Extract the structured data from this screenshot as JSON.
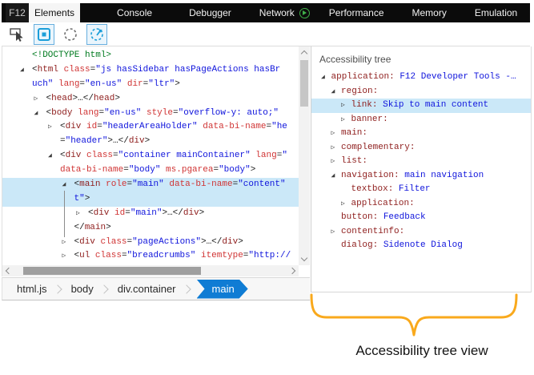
{
  "tabs": {
    "f12_label": "F12",
    "items": [
      {
        "label": "Elements",
        "active": true
      },
      {
        "label": "Console"
      },
      {
        "label": "Debugger"
      },
      {
        "label": "Network",
        "badge": "play"
      },
      {
        "label": "Performance"
      },
      {
        "label": "Memory"
      },
      {
        "label": "Emulation"
      }
    ]
  },
  "toolbar": {
    "icons": [
      {
        "name": "select-element-icon",
        "active": false
      },
      {
        "name": "highlight-elements-icon",
        "active": true
      },
      {
        "name": "dashed-circle-icon",
        "active": false
      },
      {
        "name": "refresh-dom-icon",
        "active": true
      }
    ]
  },
  "dom_tree": {
    "rows": [
      {
        "level": 0,
        "arrow": "none",
        "selected": false,
        "segments": [
          [
            "<!DOCTYPE html>",
            "doctype"
          ]
        ]
      },
      {
        "level": 0,
        "arrow": "expanded",
        "selected": false,
        "segments": [
          [
            "<",
            "p"
          ],
          [
            "html",
            "tag"
          ],
          [
            " ",
            "p"
          ],
          [
            "class",
            "attr"
          ],
          [
            "=",
            "p"
          ],
          [
            "\"js hasSidebar hasPageActions hasBr",
            "val"
          ]
        ]
      },
      {
        "level": 0,
        "arrow": "none",
        "selected": false,
        "segments": [
          [
            "uch\"",
            "val"
          ],
          [
            " ",
            "p"
          ],
          [
            "lang",
            "attr"
          ],
          [
            "=",
            "p"
          ],
          [
            "\"en-us\"",
            "val"
          ],
          [
            " ",
            "p"
          ],
          [
            "dir",
            "attr"
          ],
          [
            "=",
            "p"
          ],
          [
            "\"ltr\"",
            "val"
          ],
          [
            ">",
            "p"
          ]
        ]
      },
      {
        "level": 1,
        "arrow": "collapsed",
        "selected": false,
        "segments": [
          [
            "<",
            "p"
          ],
          [
            "head",
            "tag"
          ],
          [
            ">…</",
            "p"
          ],
          [
            "head",
            "tag"
          ],
          [
            ">",
            "p"
          ]
        ]
      },
      {
        "level": 1,
        "arrow": "expanded",
        "selected": false,
        "segments": [
          [
            "<",
            "p"
          ],
          [
            "body",
            "tag"
          ],
          [
            " ",
            "p"
          ],
          [
            "lang",
            "attr"
          ],
          [
            "=",
            "p"
          ],
          [
            "\"en-us\"",
            "val"
          ],
          [
            " ",
            "p"
          ],
          [
            "style",
            "attr"
          ],
          [
            "=",
            "p"
          ],
          [
            "\"overflow-y: auto;\"",
            "val"
          ]
        ]
      },
      {
        "level": 2,
        "arrow": "collapsed",
        "selected": false,
        "segments": [
          [
            "<",
            "p"
          ],
          [
            "div",
            "tag"
          ],
          [
            " ",
            "p"
          ],
          [
            "id",
            "attr"
          ],
          [
            "=",
            "p"
          ],
          [
            "\"headerAreaHolder\"",
            "val"
          ],
          [
            " ",
            "p"
          ],
          [
            "data-bi-name",
            "attr"
          ],
          [
            "=",
            "p"
          ],
          [
            "\"he",
            "val"
          ]
        ]
      },
      {
        "level": 2,
        "arrow": "none",
        "selected": false,
        "segments": [
          [
            "=",
            "p"
          ],
          [
            "\"header\"",
            "val"
          ],
          [
            ">…</",
            "p"
          ],
          [
            "div",
            "tag"
          ],
          [
            ">",
            "p"
          ]
        ]
      },
      {
        "level": 2,
        "arrow": "expanded",
        "selected": false,
        "segments": [
          [
            "<",
            "p"
          ],
          [
            "div",
            "tag"
          ],
          [
            " ",
            "p"
          ],
          [
            "class",
            "attr"
          ],
          [
            "=",
            "p"
          ],
          [
            "\"container mainContainer\"",
            "val"
          ],
          [
            " ",
            "p"
          ],
          [
            "lang",
            "attr"
          ],
          [
            "=",
            "p"
          ],
          [
            "\"",
            "val"
          ]
        ]
      },
      {
        "level": 2,
        "arrow": "none",
        "selected": false,
        "segments": [
          [
            "data-bi-name",
            "attr"
          ],
          [
            "=",
            "p"
          ],
          [
            "\"body\"",
            "val"
          ],
          [
            " ",
            "p"
          ],
          [
            "ms.pgarea",
            "attr"
          ],
          [
            "=",
            "p"
          ],
          [
            "\"body\"",
            "val"
          ],
          [
            ">",
            "p"
          ]
        ]
      },
      {
        "level": 3,
        "arrow": "expanded",
        "selected": true,
        "segments": [
          [
            "<",
            "p"
          ],
          [
            "main",
            "tag"
          ],
          [
            " ",
            "p"
          ],
          [
            "role",
            "attr"
          ],
          [
            "=",
            "p"
          ],
          [
            "\"main\"",
            "val"
          ],
          [
            " ",
            "p"
          ],
          [
            "data-bi-name",
            "attr"
          ],
          [
            "=",
            "p"
          ],
          [
            "\"content\"",
            "val"
          ]
        ]
      },
      {
        "level": 3,
        "arrow": "none",
        "selected": true,
        "segments": [
          [
            "t\"",
            "val"
          ],
          [
            ">",
            "p"
          ]
        ]
      },
      {
        "level": 4,
        "arrow": "collapsed",
        "selected": false,
        "segments": [
          [
            "<",
            "p"
          ],
          [
            "div",
            "tag"
          ],
          [
            " ",
            "p"
          ],
          [
            "id",
            "attr"
          ],
          [
            "=",
            "p"
          ],
          [
            "\"main\"",
            "val"
          ],
          [
            ">…</",
            "p"
          ],
          [
            "div",
            "tag"
          ],
          [
            ">",
            "p"
          ]
        ]
      },
      {
        "level": 3,
        "arrow": "none",
        "selected": false,
        "segments": [
          [
            "</",
            "p"
          ],
          [
            "main",
            "tag"
          ],
          [
            ">",
            "p"
          ]
        ]
      },
      {
        "level": 3,
        "arrow": "collapsed",
        "selected": false,
        "segments": [
          [
            "<",
            "p"
          ],
          [
            "div",
            "tag"
          ],
          [
            " ",
            "p"
          ],
          [
            "class",
            "attr"
          ],
          [
            "=",
            "p"
          ],
          [
            "\"pageActions\"",
            "val"
          ],
          [
            ">…</",
            "p"
          ],
          [
            "div",
            "tag"
          ],
          [
            ">",
            "p"
          ]
        ]
      },
      {
        "level": 3,
        "arrow": "collapsed",
        "selected": false,
        "segments": [
          [
            "<",
            "p"
          ],
          [
            "ul",
            "tag"
          ],
          [
            " ",
            "p"
          ],
          [
            "class",
            "attr"
          ],
          [
            "=",
            "p"
          ],
          [
            "\"breadcrumbs\"",
            "val"
          ],
          [
            " ",
            "p"
          ],
          [
            "itemtype",
            "attr"
          ],
          [
            "=",
            "p"
          ],
          [
            "\"http://",
            "val"
          ]
        ]
      }
    ]
  },
  "breadcrumbs": {
    "items": [
      "html.js",
      "body",
      "div.container"
    ],
    "active": "main"
  },
  "a11y_tree": {
    "title": "Accessibility tree",
    "rows": [
      {
        "level": 0,
        "arrow": "expanded",
        "role": "application:",
        "value": "F12 Developer Tools -…",
        "selected": false
      },
      {
        "level": 1,
        "arrow": "expanded",
        "role": "region:",
        "value": "",
        "selected": false
      },
      {
        "level": 2,
        "arrow": "collapsed",
        "role": "link:",
        "value": "Skip to main content",
        "selected": true
      },
      {
        "level": 2,
        "arrow": "collapsed",
        "role": "banner:",
        "value": "",
        "selected": false
      },
      {
        "level": 1,
        "arrow": "collapsed",
        "role": "main:",
        "value": "",
        "selected": false
      },
      {
        "level": 1,
        "arrow": "collapsed",
        "role": "complementary:",
        "value": "",
        "selected": false
      },
      {
        "level": 1,
        "arrow": "collapsed",
        "role": "list:",
        "value": "",
        "selected": false
      },
      {
        "level": 1,
        "arrow": "expanded",
        "role": "navigation:",
        "value": "main navigation",
        "selected": false
      },
      {
        "level": 2,
        "arrow": "none",
        "role": "textbox:",
        "value": "Filter",
        "selected": false
      },
      {
        "level": 2,
        "arrow": "collapsed",
        "role": "application:",
        "value": "",
        "selected": false
      },
      {
        "level": 1,
        "arrow": "none",
        "role": "button:",
        "value": "Feedback",
        "selected": false
      },
      {
        "level": 1,
        "arrow": "collapsed",
        "role": "contentinfo:",
        "value": "",
        "selected": false
      },
      {
        "level": 1,
        "arrow": "none",
        "role": "dialog:",
        "value": "Sidenote Dialog",
        "selected": false
      }
    ]
  },
  "annotation": {
    "label": "Accessibility tree view"
  },
  "colors": {
    "accent_blue": "#1b9ed9",
    "selection_bg": "#cbe8f8",
    "tag": "#8e1d1c",
    "attribute": "#d03434",
    "value": "#0f14dc",
    "doctype": "#007a1f",
    "breadcrumb_active": "#0f7cd4",
    "brace": "#F9A91C",
    "network_play": "#3fae49"
  }
}
